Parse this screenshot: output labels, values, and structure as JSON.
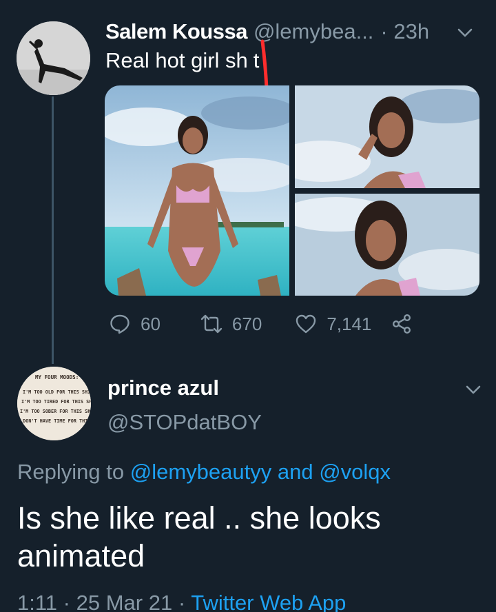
{
  "colors": {
    "background": "#15202b",
    "secondary_text": "#8899a6",
    "link": "#1da1f2",
    "thread_line": "#3d5466",
    "annotation_mark": "#ff2d2d"
  },
  "tweet": {
    "author_name": "Salem Koussa",
    "author_handle": "@lemybea...",
    "separator": "·",
    "time": "23h",
    "text_before_mark": "Real hot girl sh",
    "text_after_mark": "t",
    "avatar_icon": "user-avatar-photo",
    "media": [
      {
        "icon": "photo-beach-full"
      },
      {
        "icon": "photo-portrait-top"
      },
      {
        "icon": "photo-portrait-bottom"
      }
    ],
    "actions": {
      "replies": "60",
      "retweets": "670",
      "likes": "7,141",
      "reply_icon": "reply-icon",
      "retweet_icon": "retweet-icon",
      "like_icon": "heart-icon",
      "share_icon": "share-icon"
    }
  },
  "reply": {
    "author_name": "prince azul",
    "author_handle": "@STOPdatBOY",
    "avatar_lines": [
      "MY FOUR MOODS:",
      "I'M TOO OLD FOR THIS SHIT,",
      "I'M TOO TIRED FOR THIS SHIT,",
      "I'M TOO SOBER FOR THIS SHIT,",
      "I DON'T HAVE TIME FOR THIS SHIT"
    ],
    "replying_prefix": "Replying to",
    "mention_1": "@lemybeautyy",
    "conjunction": "and",
    "mention_2": "@volqx",
    "text": "Is she like real .. she looks animated",
    "time": "1:11",
    "separator": "·",
    "date": "25 Mar 21",
    "separator2": "·",
    "source": "Twitter Web App"
  }
}
